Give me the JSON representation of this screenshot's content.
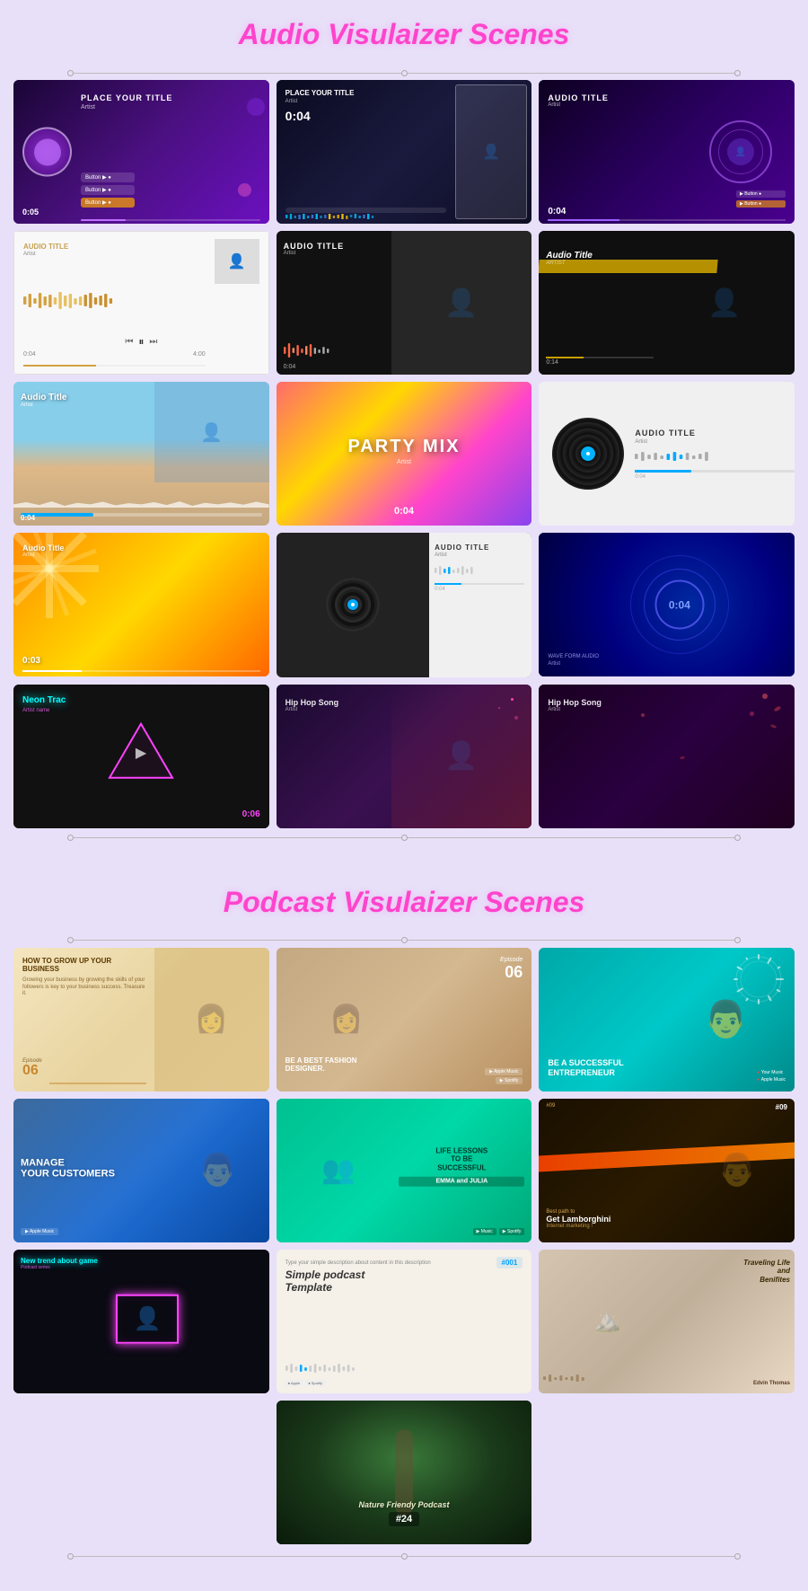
{
  "audio_section": {
    "title": "Audio Visulaizer Scenes",
    "cards": [
      {
        "id": 1,
        "title": "PLACE YOUR TITLE",
        "subtitle": "Artist",
        "time": "0:05",
        "style": "dark-purple"
      },
      {
        "id": 2,
        "title": "PLACE YOUR TITLE",
        "subtitle": "Artist",
        "time": "0:04",
        "style": "dark-navy"
      },
      {
        "id": 3,
        "title": "AUDIO TITLE",
        "subtitle": "Artist",
        "time": "0:04",
        "style": "dark-violet"
      },
      {
        "id": 4,
        "title": "AUDIO TITLE",
        "subtitle": "Artist",
        "time": "0:04",
        "style": "white"
      },
      {
        "id": 5,
        "title": "AUDIO TITLE",
        "subtitle": "Artist",
        "time": "0:04",
        "style": "dark"
      },
      {
        "id": 6,
        "title": "Audio Title",
        "subtitle": "ARTIST",
        "time": "0:14",
        "style": "dark-yellow"
      },
      {
        "id": 7,
        "title": "Audio Title",
        "subtitle": "Artist",
        "time": "0:04",
        "style": "beach"
      },
      {
        "id": 8,
        "title": "PARTY MIX",
        "subtitle": "Artist",
        "time": "0:04",
        "style": "colorful"
      },
      {
        "id": 9,
        "title": "AUDIO TITLE",
        "subtitle": "Artist",
        "time": "0:04",
        "style": "minimal"
      },
      {
        "id": 10,
        "title": "Audio Title",
        "subtitle": "Artist",
        "time": "0:03",
        "style": "golden"
      },
      {
        "id": 11,
        "title": "AUDIO TITLE",
        "subtitle": "Artist",
        "time": "0:04",
        "style": "vinyl-white"
      },
      {
        "id": 12,
        "title": "0:04",
        "subtitle": "WAVE FORM AUDIO\nArtist",
        "time": "0:04",
        "style": "blue-glow"
      },
      {
        "id": 13,
        "title": "Neon Trac",
        "subtitle": "",
        "time": "0:06",
        "style": "neon-dark"
      },
      {
        "id": 14,
        "title": "Hip Hop Song",
        "subtitle": "Artist",
        "time": "",
        "style": "dark-red"
      },
      {
        "id": 15,
        "title": "Hip Hop Song",
        "subtitle": "Artist",
        "time": "",
        "style": "dark-purple-2"
      }
    ]
  },
  "podcast_section": {
    "title": "Podcast Visulaizer Scenes",
    "cards": [
      {
        "id": 1,
        "title": "HOW TO GROW UP YOUR BUSINESS",
        "subtitle": "Episode 06",
        "style": "cream"
      },
      {
        "id": 2,
        "title": "BE A BEST FASHION DESIGNER.",
        "subtitle": "Episode 06",
        "style": "tan"
      },
      {
        "id": 3,
        "title": "BE A SUCCESSFUL ENTREPRENEUR",
        "subtitle": "",
        "style": "teal"
      },
      {
        "id": 4,
        "title": "MANAGE YOUR CUSTOMERS",
        "subtitle": "",
        "style": "blue"
      },
      {
        "id": 5,
        "title": "LIFE LESSONS TO BE SUCCESSFUL",
        "subtitle": "EMMA and JULIA",
        "style": "green"
      },
      {
        "id": 6,
        "title": "Get Lamborghini",
        "subtitle": "#09 Best path to\nInternet marketing !",
        "style": "dark-brown"
      },
      {
        "id": 7,
        "title": "New trend about game",
        "subtitle": "",
        "style": "neon-brick"
      },
      {
        "id": 8,
        "title": "Simple podcast Template",
        "subtitle": "#001",
        "style": "light"
      },
      {
        "id": 9,
        "title": "Traveling Life and Benifites",
        "subtitle": "Edvin Thomas",
        "style": "tan-2"
      },
      {
        "id": 10,
        "title": "Nature Friendy Podcast",
        "subtitle": "#24",
        "style": "forest"
      }
    ]
  },
  "icons": {
    "play": "▶",
    "pause": "⏸",
    "forward": "⏭"
  }
}
